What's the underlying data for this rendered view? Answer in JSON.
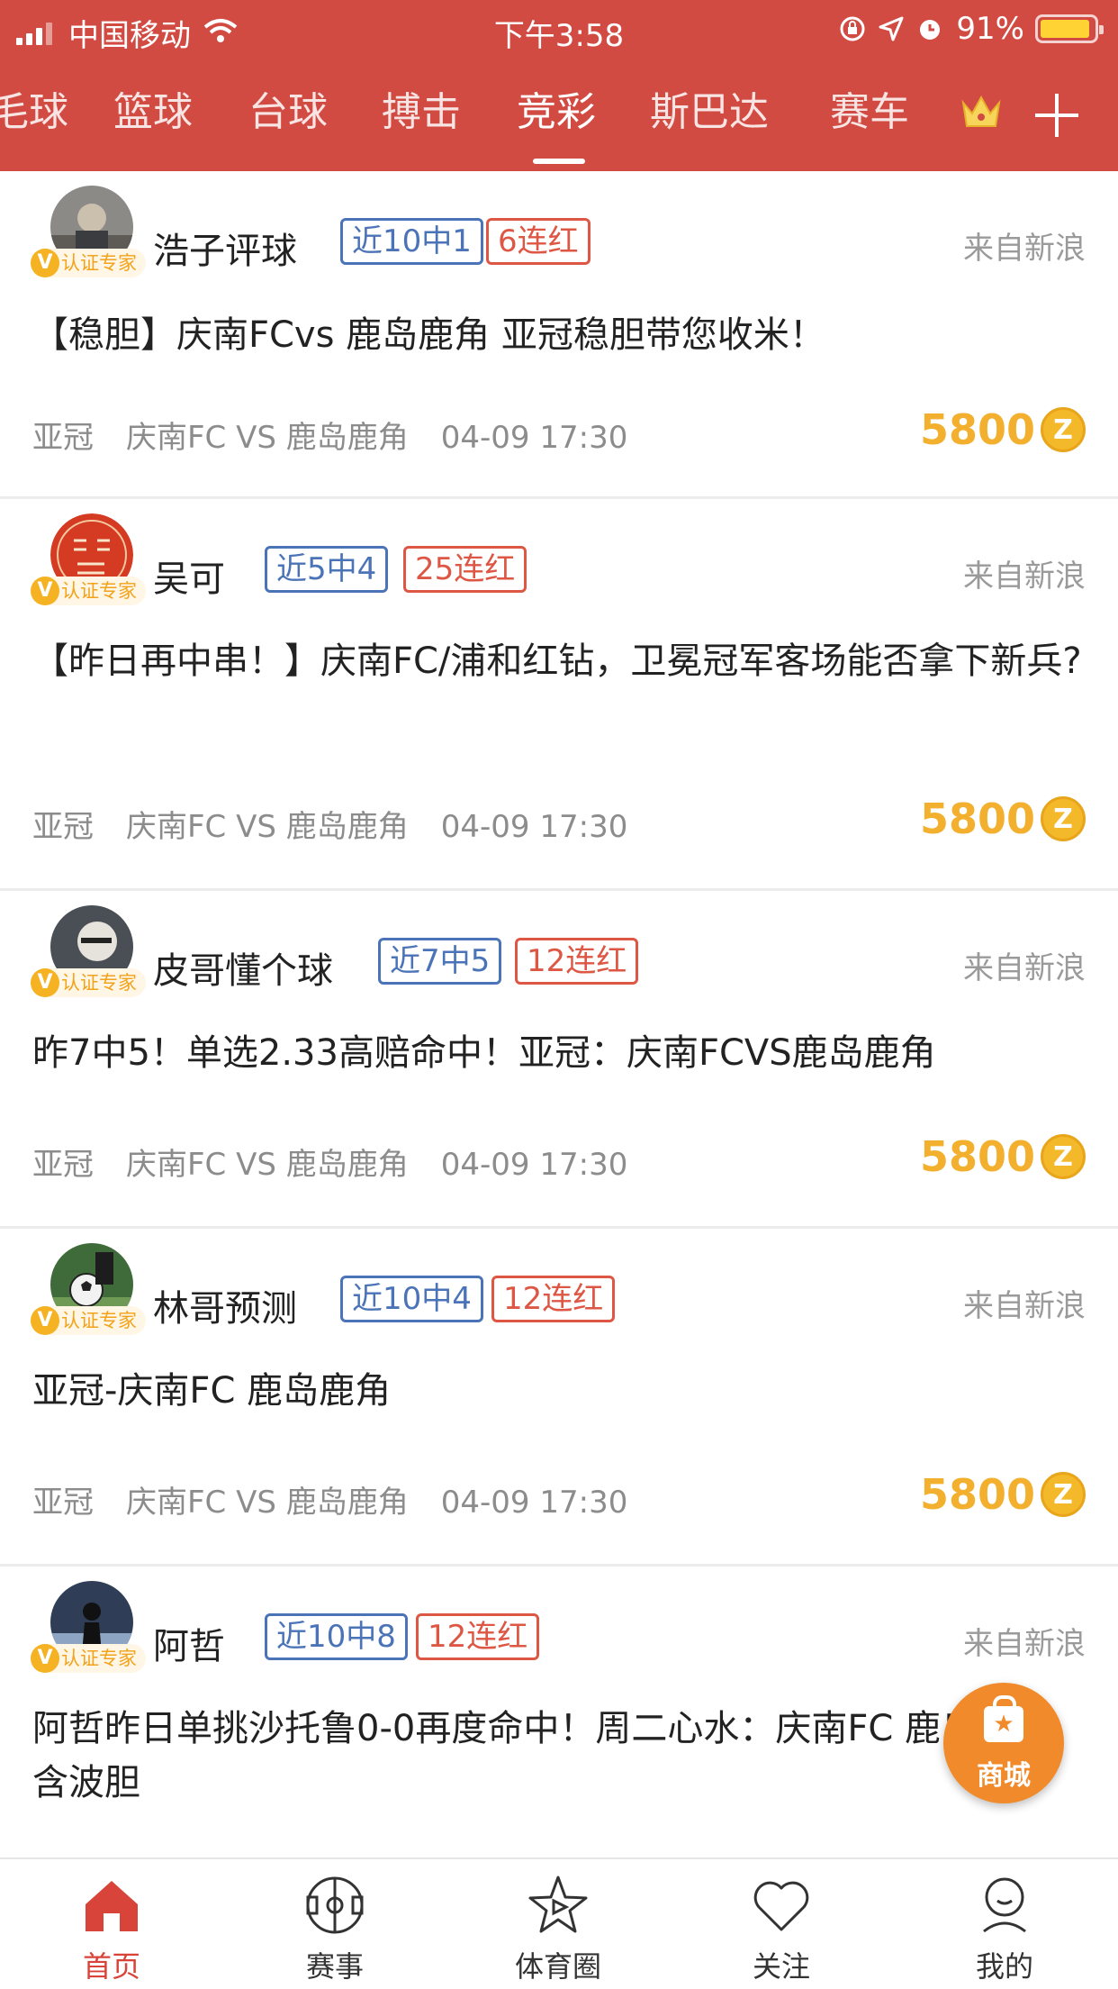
{
  "status_bar": {
    "carrier": "中国移动",
    "time": "下午3:58",
    "battery": "91%",
    "battery_level": 0.91
  },
  "tabs": [
    {
      "label": "毛球",
      "active": false
    },
    {
      "label": "篮球",
      "active": false
    },
    {
      "label": "台球",
      "active": false
    },
    {
      "label": "搏击",
      "active": false
    },
    {
      "label": "竞彩",
      "active": true
    },
    {
      "label": "斯巴达",
      "active": false
    },
    {
      "label": "赛车",
      "active": false
    }
  ],
  "badge_label": "认证专家",
  "source_label": "来自新浪",
  "coin_symbol": "Z",
  "posts": [
    {
      "author": "浩子评球",
      "record": "近10中1",
      "streak": "6连红",
      "title": "【稳胆】庆南FCvs 鹿岛鹿角 亚冠稳胆带您收米！",
      "league": "亚冠",
      "match": "庆南FC VS 鹿岛鹿角",
      "time": "04-09 17:30",
      "price": "5800"
    },
    {
      "author": "吴可",
      "record": "近5中4",
      "streak": "25连红",
      "title": "【昨日再中串！】庆南FC/浦和红钻，卫冕冠军客场能否拿下新兵?",
      "league": "亚冠",
      "match": "庆南FC VS 鹿岛鹿角",
      "time": "04-09 17:30",
      "price": "5800"
    },
    {
      "author": "皮哥懂个球",
      "record": "近7中5",
      "streak": "12连红",
      "title": "昨7中5！单选2.33高赔命中！亚冠：庆南FCVS鹿岛鹿角",
      "league": "亚冠",
      "match": "庆南FC VS 鹿岛鹿角",
      "time": "04-09 17:30",
      "price": "5800"
    },
    {
      "author": "林哥预测",
      "record": "近10中4",
      "streak": "12连红",
      "title": "亚冠-庆南FC 鹿岛鹿角",
      "league": "亚冠",
      "match": "庆南FC VS 鹿岛鹿角",
      "time": "04-09 17:30",
      "price": "5800"
    },
    {
      "author": "阿哲",
      "record": "近10中8",
      "streak": "12连红",
      "title": "阿哲昨日单挑沙托鲁0-0再度命中！周二心水：庆南FC 鹿岛鹿角，含波胆"
    }
  ],
  "mall_button": {
    "label": "商城"
  },
  "bottom_nav": [
    {
      "label": "首页",
      "icon": "home-icon",
      "active": true
    },
    {
      "label": "赛事",
      "icon": "pitch-icon",
      "active": false
    },
    {
      "label": "体育圈",
      "icon": "sports-circle-icon",
      "active": false
    },
    {
      "label": "关注",
      "icon": "heart-icon",
      "active": false
    },
    {
      "label": "我的",
      "icon": "profile-icon",
      "active": false
    }
  ],
  "colors": {
    "header": "#d14b43",
    "accent_blue": "#4b73b7",
    "accent_red": "#dd5744",
    "price_gold": "#f2b02e",
    "nav_active": "#d9443a"
  }
}
